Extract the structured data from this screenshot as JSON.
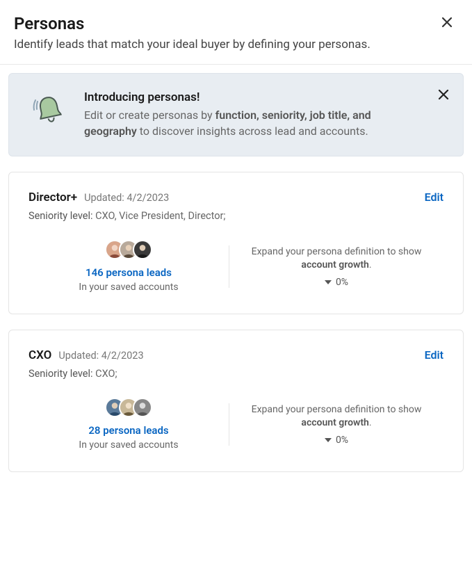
{
  "header": {
    "title": "Personas",
    "subtitle": "Identify leads that match your ideal buyer by defining your personas."
  },
  "banner": {
    "title": "Introducing personas!",
    "body_prefix": "Edit or create personas by ",
    "body_bold": "function, seniority, job title, and geography",
    "body_suffix": " to discover insights across lead and accounts."
  },
  "personas": [
    {
      "name": "Director+",
      "updated_label": "Updated: ",
      "updated_date": "4/2/2023",
      "edit_label": "Edit",
      "seniority_label": "Seniority level: ",
      "seniority_value": "CXO, Vice President, Director;",
      "leads_text": "146 persona leads",
      "saved_accounts_text": "In your saved accounts",
      "expand_prefix": "Expand your persona definition to show ",
      "expand_bold": "account growth",
      "expand_suffix": ".",
      "pct": "0%"
    },
    {
      "name": "CXO",
      "updated_label": "Updated: ",
      "updated_date": "4/2/2023",
      "edit_label": "Edit",
      "seniority_label": "Seniority level: ",
      "seniority_value": "CXO;",
      "leads_text": "28 persona leads",
      "saved_accounts_text": "In your saved accounts",
      "expand_prefix": "Expand your persona definition to show ",
      "expand_bold": "account growth",
      "expand_suffix": ".",
      "pct": "0%"
    }
  ]
}
